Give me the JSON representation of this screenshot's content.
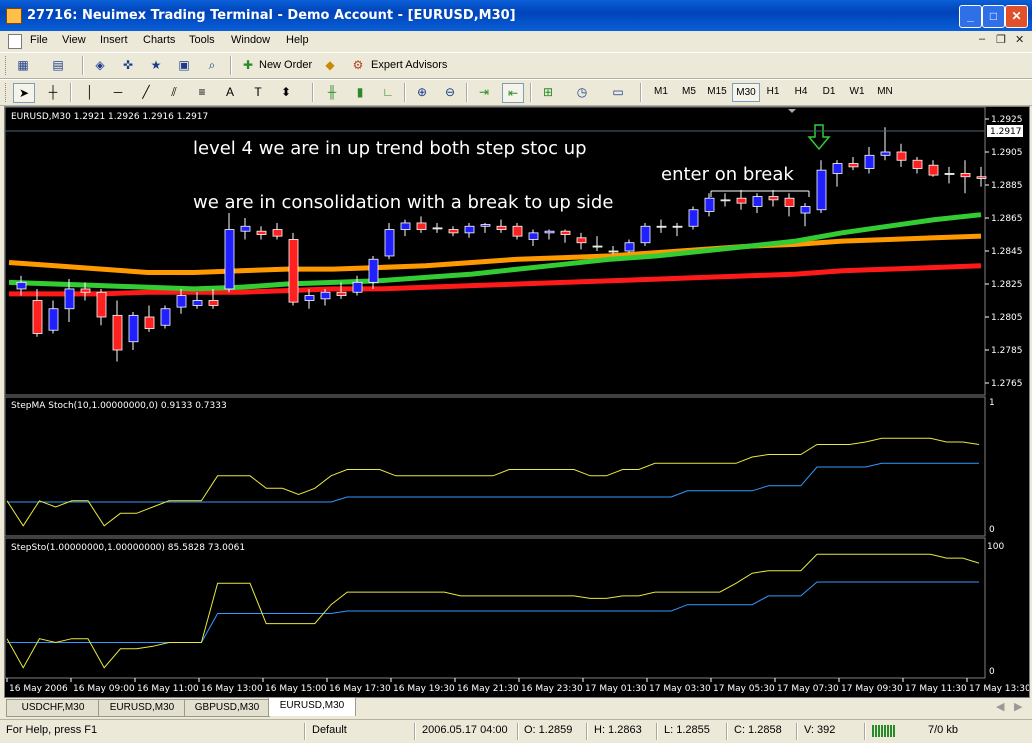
{
  "window": {
    "title": "27716: Neuimex Trading Terminal - Demo Account - [EURUSD,M30]"
  },
  "menu": [
    "File",
    "View",
    "Insert",
    "Charts",
    "Tools",
    "Window",
    "Help"
  ],
  "toolbar": {
    "new_order": "New Order",
    "expert_advisors": "Expert Advisors"
  },
  "timeframes": [
    "M1",
    "M5",
    "M15",
    "M30",
    "H1",
    "H4",
    "D1",
    "W1",
    "MN"
  ],
  "active_timeframe": "M30",
  "chart": {
    "header": "EURUSD,M30  1.2921 1.2926 1.2916 1.2917",
    "annotation_1": "level 4 we are in up trend both step stoc up",
    "annotation_2": "we are in consolidation with a break to up side",
    "annotation_3": "enter on break",
    "current_price": "1.2917",
    "ind1_label": "StepMA Stoch(10,1.00000000,0) 0.9133 0.7333",
    "ind1_top": "1",
    "ind1_bottom": "0",
    "ind2_label": "StepSto(1.00000000,1.00000000) 85.5828 73.0061",
    "ind2_top": "100",
    "ind2_bottom": "0",
    "colors": {
      "bull": "#2020ff",
      "bear": "#ff2020",
      "ma_green": "#33cc33",
      "ma_orange": "#ff9900",
      "ma_red": "#ff1a1a",
      "yellow": "#e8e840",
      "blue": "#3399ff",
      "arrow": "#33cc33"
    }
  },
  "chart_data": {
    "type": "candlestick",
    "price_ticks": [
      "1.2925",
      "1.2905",
      "1.2885",
      "1.2865",
      "1.2845",
      "1.2825",
      "1.2805",
      "1.2785",
      "1.2765"
    ],
    "time_labels": [
      "16 May 2006",
      "16 May 09:00",
      "16 May 11:00",
      "16 May 13:00",
      "16 May 15:00",
      "16 May 17:30",
      "16 May 19:30",
      "16 May 21:30",
      "16 May 23:30",
      "17 May 01:30",
      "17 May 03:30",
      "17 May 05:30",
      "17 May 07:30",
      "17 May 09:30",
      "17 May 11:30",
      "17 May 13:30"
    ],
    "candles": [
      [
        1.2822,
        1.283,
        1.2818,
        1.2826
      ],
      [
        1.2815,
        1.2822,
        1.2793,
        1.2795
      ],
      [
        1.2797,
        1.2815,
        1.2795,
        1.281
      ],
      [
        1.281,
        1.2828,
        1.2802,
        1.2822
      ],
      [
        1.2822,
        1.2826,
        1.2815,
        1.282
      ],
      [
        1.282,
        1.2822,
        1.28,
        1.2805
      ],
      [
        1.2806,
        1.2815,
        1.2778,
        1.2785
      ],
      [
        1.279,
        1.2808,
        1.2785,
        1.2806
      ],
      [
        1.2805,
        1.2812,
        1.2796,
        1.2798
      ],
      [
        1.28,
        1.2812,
        1.2798,
        1.281
      ],
      [
        1.2811,
        1.2822,
        1.2807,
        1.2818
      ],
      [
        1.2812,
        1.282,
        1.281,
        1.2815
      ],
      [
        1.2815,
        1.2822,
        1.281,
        1.2812
      ],
      [
        1.2822,
        1.2868,
        1.282,
        1.2858
      ],
      [
        1.2857,
        1.2865,
        1.2852,
        1.286
      ],
      [
        1.2857,
        1.286,
        1.2852,
        1.2855
      ],
      [
        1.2858,
        1.2862,
        1.2852,
        1.2854
      ],
      [
        1.2852,
        1.2856,
        1.2812,
        1.2814
      ],
      [
        1.2815,
        1.2822,
        1.281,
        1.2818
      ],
      [
        1.2816,
        1.2822,
        1.2812,
        1.282
      ],
      [
        1.282,
        1.2826,
        1.2816,
        1.2818
      ],
      [
        1.282,
        1.283,
        1.2818,
        1.2826
      ],
      [
        1.2826,
        1.2842,
        1.2822,
        1.284
      ],
      [
        1.2842,
        1.2862,
        1.284,
        1.2858
      ],
      [
        1.2858,
        1.2864,
        1.2854,
        1.2862
      ],
      [
        1.2862,
        1.2866,
        1.2856,
        1.2858
      ],
      [
        1.2859,
        1.2862,
        1.2856,
        1.2859
      ],
      [
        1.2858,
        1.286,
        1.2854,
        1.2856
      ],
      [
        1.2856,
        1.2862,
        1.2853,
        1.286
      ],
      [
        1.286,
        1.2862,
        1.2856,
        1.2861
      ],
      [
        1.286,
        1.2864,
        1.2856,
        1.2858
      ],
      [
        1.286,
        1.2862,
        1.2852,
        1.2854
      ],
      [
        1.2852,
        1.2858,
        1.2848,
        1.2856
      ],
      [
        1.2856,
        1.2858,
        1.2852,
        1.2857
      ],
      [
        1.2857,
        1.2858,
        1.285,
        1.2855
      ],
      [
        1.2853,
        1.2856,
        1.2846,
        1.285
      ],
      [
        1.2848,
        1.2854,
        1.2845,
        1.2848
      ],
      [
        1.2845,
        1.2848,
        1.2843,
        1.2845
      ],
      [
        1.2845,
        1.2852,
        1.2844,
        1.285
      ],
      [
        1.285,
        1.2862,
        1.2848,
        1.286
      ],
      [
        1.286,
        1.2864,
        1.2856,
        1.286
      ],
      [
        1.286,
        1.2862,
        1.2854,
        1.286
      ],
      [
        1.286,
        1.2872,
        1.2858,
        1.287
      ],
      [
        1.2869,
        1.288,
        1.2866,
        1.2877
      ],
      [
        1.2876,
        1.288,
        1.2872,
        1.2876
      ],
      [
        1.2877,
        1.2882,
        1.287,
        1.2874
      ],
      [
        1.2872,
        1.288,
        1.2868,
        1.2878
      ],
      [
        1.2878,
        1.2882,
        1.2872,
        1.2876
      ],
      [
        1.2877,
        1.288,
        1.2866,
        1.2872
      ],
      [
        1.2868,
        1.2874,
        1.286,
        1.2872
      ],
      [
        1.287,
        1.29,
        1.2868,
        1.2894
      ],
      [
        1.2892,
        1.29,
        1.2884,
        1.2898
      ],
      [
        1.2898,
        1.2902,
        1.2894,
        1.2896
      ],
      [
        1.2895,
        1.2908,
        1.2892,
        1.2903
      ],
      [
        1.2903,
        1.292,
        1.29,
        1.2905
      ],
      [
        1.2905,
        1.291,
        1.2896,
        1.29
      ],
      [
        1.29,
        1.2902,
        1.2892,
        1.2895
      ],
      [
        1.2897,
        1.29,
        1.289,
        1.2891
      ],
      [
        1.2892,
        1.2896,
        1.2886,
        1.2892
      ],
      [
        1.2892,
        1.29,
        1.288,
        1.289
      ],
      [
        1.289,
        1.2896,
        1.2884,
        1.2889
      ]
    ],
    "ma_green": [
      1.2826,
      1.2825,
      1.2824,
      1.2823,
      1.2822,
      1.2823,
      1.2825,
      1.2826,
      1.2827,
      1.2829,
      1.2831,
      1.2834,
      1.2837,
      1.284,
      1.2842,
      1.2845,
      1.2848,
      1.2851,
      1.2856,
      1.286,
      1.2864,
      1.2867
    ],
    "ma_orange": [
      1.2838,
      1.2836,
      1.2834,
      1.2832,
      1.2832,
      1.2833,
      1.2834,
      1.2834,
      1.2835,
      1.2836,
      1.2838,
      1.284,
      1.2841,
      1.2842,
      1.2844,
      1.2846,
      1.2848,
      1.2849,
      1.2851,
      1.2852,
      1.2853,
      1.2854
    ],
    "ma_red": [
      1.2819,
      1.2819,
      1.2819,
      1.282,
      1.282,
      1.282,
      1.2821,
      1.2822,
      1.2822,
      1.2823,
      1.2824,
      1.2825,
      1.2826,
      1.2827,
      1.2828,
      1.2829,
      1.283,
      1.2831,
      1.2833,
      1.2834,
      1.2835,
      1.2836
    ],
    "ind1_yellow": [
      0.25,
      0.05,
      0.25,
      0.2,
      0.25,
      0.25,
      0.05,
      0.15,
      0.15,
      0.2,
      0.25,
      0.25,
      0.25,
      0.45,
      0.45,
      0.45,
      0.35,
      0.35,
      0.3,
      0.35,
      0.45,
      0.5,
      0.5,
      0.5,
      0.45,
      0.45,
      0.45,
      0.45,
      0.45,
      0.45,
      0.45,
      0.5,
      0.5,
      0.5,
      0.5,
      0.5,
      0.45,
      0.45,
      0.5,
      0.5,
      0.55,
      0.55,
      0.55,
      0.55,
      0.55,
      0.55,
      0.6,
      0.62,
      0.62,
      0.62,
      0.7,
      0.7,
      0.7,
      0.72,
      0.75,
      0.75,
      0.75,
      0.75,
      0.72,
      0.72,
      0.7
    ],
    "ind1_blue": [
      0.24,
      0.24,
      0.24,
      0.24,
      0.24,
      0.24,
      0.24,
      0.24,
      0.24,
      0.24,
      0.24,
      0.24,
      0.24,
      0.24,
      0.24,
      0.24,
      0.24,
      0.24,
      0.24,
      0.24,
      0.24,
      0.28,
      0.28,
      0.28,
      0.28,
      0.28,
      0.28,
      0.28,
      0.28,
      0.28,
      0.28,
      0.28,
      0.28,
      0.28,
      0.28,
      0.28,
      0.28,
      0.28,
      0.28,
      0.28,
      0.28,
      0.28,
      0.33,
      0.33,
      0.33,
      0.33,
      0.33,
      0.37,
      0.37,
      0.37,
      0.52,
      0.52,
      0.52,
      0.52,
      0.55,
      0.55,
      0.55,
      0.55,
      0.55,
      0.55,
      0.55
    ],
    "ind2_yellow": [
      28,
      5,
      28,
      25,
      28,
      28,
      5,
      20,
      20,
      22,
      25,
      25,
      25,
      72,
      72,
      72,
      40,
      40,
      40,
      40,
      55,
      65,
      65,
      65,
      65,
      65,
      65,
      65,
      62,
      62,
      62,
      62,
      62,
      62,
      62,
      62,
      60,
      60,
      62,
      62,
      65,
      65,
      65,
      65,
      65,
      72,
      80,
      82,
      82,
      82,
      95,
      95,
      95,
      95,
      95,
      95,
      95,
      95,
      92,
      92,
      88
    ],
    "ind2_blue": [
      25,
      25,
      25,
      25,
      25,
      25,
      25,
      25,
      25,
      25,
      25,
      25,
      25,
      48,
      48,
      48,
      48,
      48,
      48,
      48,
      48,
      50,
      50,
      50,
      50,
      50,
      50,
      50,
      50,
      50,
      50,
      50,
      50,
      50,
      50,
      50,
      50,
      50,
      50,
      50,
      50,
      50,
      55,
      55,
      55,
      55,
      55,
      62,
      62,
      62,
      73,
      73,
      73,
      73,
      73,
      73,
      73,
      73,
      73,
      73,
      73
    ]
  },
  "tabs": [
    "USDCHF,M30",
    "EURUSD,M30",
    "GBPUSD,M30",
    "EURUSD,M30"
  ],
  "active_tab": 3,
  "status": {
    "help": "For Help, press F1",
    "profile": "Default",
    "datetime": "2006.05.17 04:00",
    "open": "O: 1.2859",
    "high": "H: 1.2863",
    "low": "L: 1.2855",
    "close": "C: 1.2858",
    "volume": "V: 392",
    "traffic": "7/0 kb"
  }
}
